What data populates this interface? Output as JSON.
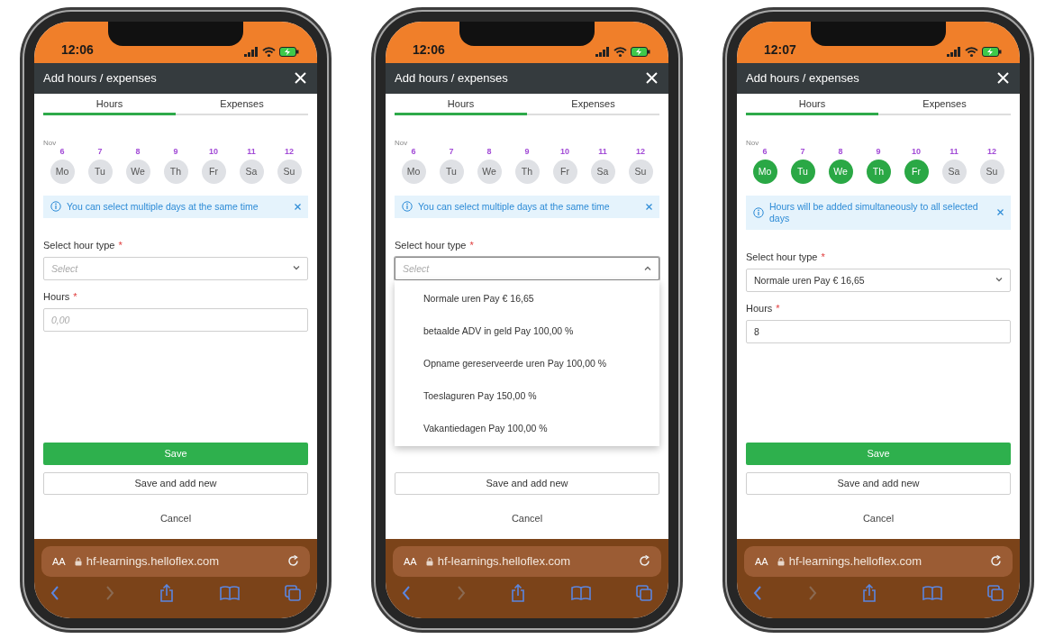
{
  "phones": [
    {
      "status_time": "12:06",
      "title": "Add hours / expenses",
      "tabs": [
        {
          "label": "Hours",
          "selected": true
        },
        {
          "label": "Expenses",
          "selected": false
        }
      ],
      "month": "Nov",
      "days": [
        {
          "date": "6",
          "label": "Mo",
          "selected": false
        },
        {
          "date": "7",
          "label": "Tu",
          "selected": false
        },
        {
          "date": "8",
          "label": "We",
          "selected": false
        },
        {
          "date": "9",
          "label": "Th",
          "selected": false
        },
        {
          "date": "10",
          "label": "Fr",
          "selected": false
        },
        {
          "date": "11",
          "label": "Sa",
          "selected": false
        },
        {
          "date": "12",
          "label": "Su",
          "selected": false
        }
      ],
      "notice": "You can select multiple days at the same time",
      "hour_type": {
        "label": "Select hour type",
        "required_mark": "*",
        "placeholder": "Select",
        "expanded": false
      },
      "hours": {
        "label": "Hours",
        "required_mark": "*",
        "placeholder": "0,00"
      },
      "buttons": [
        {
          "kind": "primary",
          "label": "Save"
        },
        {
          "kind": "secondary",
          "label": "Save and add new"
        },
        {
          "kind": "link",
          "label": "Cancel"
        }
      ],
      "browser": {
        "text_size": "AA",
        "url": "hf-learnings.helloflex.com"
      }
    },
    {
      "status_time": "12:06",
      "title": "Add hours / expenses",
      "tabs": [
        {
          "label": "Hours",
          "selected": true
        },
        {
          "label": "Expenses",
          "selected": false
        }
      ],
      "month": "Nov",
      "days": [
        {
          "date": "6",
          "label": "Mo",
          "selected": false
        },
        {
          "date": "7",
          "label": "Tu",
          "selected": false
        },
        {
          "date": "8",
          "label": "We",
          "selected": false
        },
        {
          "date": "9",
          "label": "Th",
          "selected": false
        },
        {
          "date": "10",
          "label": "Fr",
          "selected": false
        },
        {
          "date": "11",
          "label": "Sa",
          "selected": false
        },
        {
          "date": "12",
          "label": "Su",
          "selected": false
        }
      ],
      "notice": "You can select multiple days at the same time",
      "hour_type": {
        "label": "Select hour type",
        "required_mark": "*",
        "placeholder": "Select",
        "expanded": true,
        "options": [
          "Normale uren Pay € 16,65",
          "betaalde ADV in geld Pay 100,00 %",
          "Opname gereserveerde uren Pay 100,00 %",
          "Toeslaguren Pay 150,00 %",
          "Vakantiedagen Pay 100,00 %"
        ]
      },
      "buttons": [
        {
          "kind": "secondary",
          "label": "Save and add new"
        },
        {
          "kind": "link",
          "label": "Cancel"
        }
      ],
      "browser": {
        "text_size": "AA",
        "url": "hf-learnings.helloflex.com"
      }
    },
    {
      "status_time": "12:07",
      "title": "Add hours / expenses",
      "tabs": [
        {
          "label": "Hours",
          "selected": true
        },
        {
          "label": "Expenses",
          "selected": false
        }
      ],
      "month": "Nov",
      "days": [
        {
          "date": "6",
          "label": "Mo",
          "selected": true
        },
        {
          "date": "7",
          "label": "Tu",
          "selected": true
        },
        {
          "date": "8",
          "label": "We",
          "selected": true
        },
        {
          "date": "9",
          "label": "Th",
          "selected": true
        },
        {
          "date": "10",
          "label": "Fr",
          "selected": true
        },
        {
          "date": "11",
          "label": "Sa",
          "selected": false
        },
        {
          "date": "12",
          "label": "Su",
          "selected": false
        }
      ],
      "notice": "Hours will be added simultaneously to all selected days",
      "hour_type": {
        "label": "Select hour type",
        "required_mark": "*",
        "value": "Normale uren Pay € 16,65",
        "expanded": false
      },
      "hours": {
        "label": "Hours",
        "required_mark": "*",
        "value": "8"
      },
      "buttons": [
        {
          "kind": "primary",
          "label": "Save"
        },
        {
          "kind": "secondary",
          "label": "Save and add new"
        },
        {
          "kind": "link",
          "label": "Cancel"
        }
      ],
      "browser": {
        "text_size": "AA",
        "url": "hf-learnings.helloflex.com"
      }
    }
  ]
}
